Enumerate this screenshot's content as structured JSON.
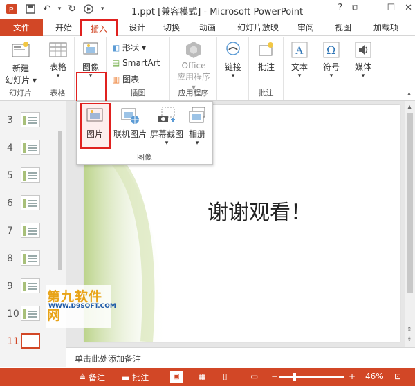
{
  "app": {
    "title": "1.ppt [兼容模式] - Microsoft PowerPoint",
    "help": "?",
    "window_controls": [
      "restore-icon",
      "minimize-icon",
      "maximize-icon",
      "close-icon"
    ]
  },
  "tabs": [
    {
      "label": "文件"
    },
    {
      "label": "开始"
    },
    {
      "label": "插入"
    },
    {
      "label": "设计"
    },
    {
      "label": "切换"
    },
    {
      "label": "动画"
    },
    {
      "label": "幻灯片放映"
    },
    {
      "label": "审阅"
    },
    {
      "label": "视图"
    },
    {
      "label": "加载项"
    }
  ],
  "ribbon": {
    "new_slide": "新建\n幻灯片",
    "new_slide_line1": "新建",
    "new_slide_line2": "幻灯片",
    "group_slides": "幻灯片",
    "table": "表格",
    "group_table": "表格",
    "image": "图像",
    "shape": "形状",
    "smartart": "SmartArt",
    "chart": "图表",
    "group_illustrations": "插图",
    "office_line1": "Office",
    "office_line2": "应用程序",
    "group_apps": "应用程序",
    "link": "链接",
    "group_link": "",
    "comment": "批注",
    "group_comment": "批注",
    "text": "文本",
    "symbol": "符号",
    "media": "媒体"
  },
  "dropdown": {
    "items": [
      "图片",
      "联机图片",
      "屏幕截图",
      "相册"
    ],
    "group_label": "图像"
  },
  "slides": {
    "numbers": [
      "3",
      "4",
      "5",
      "6",
      "7",
      "8",
      "9",
      "10",
      "11"
    ],
    "current": "11"
  },
  "slide": {
    "text": "谢谢观看！"
  },
  "notes": {
    "placeholder": "单击此处添加备注"
  },
  "status": {
    "notes": "备注",
    "comments": "批注",
    "zoom": "46%"
  },
  "watermark": {
    "line1": "第九软件网",
    "line2": "WWW.D9SOFT.COM"
  },
  "colors": {
    "accent": "#d24726",
    "highlight_box": "#e0211f"
  }
}
